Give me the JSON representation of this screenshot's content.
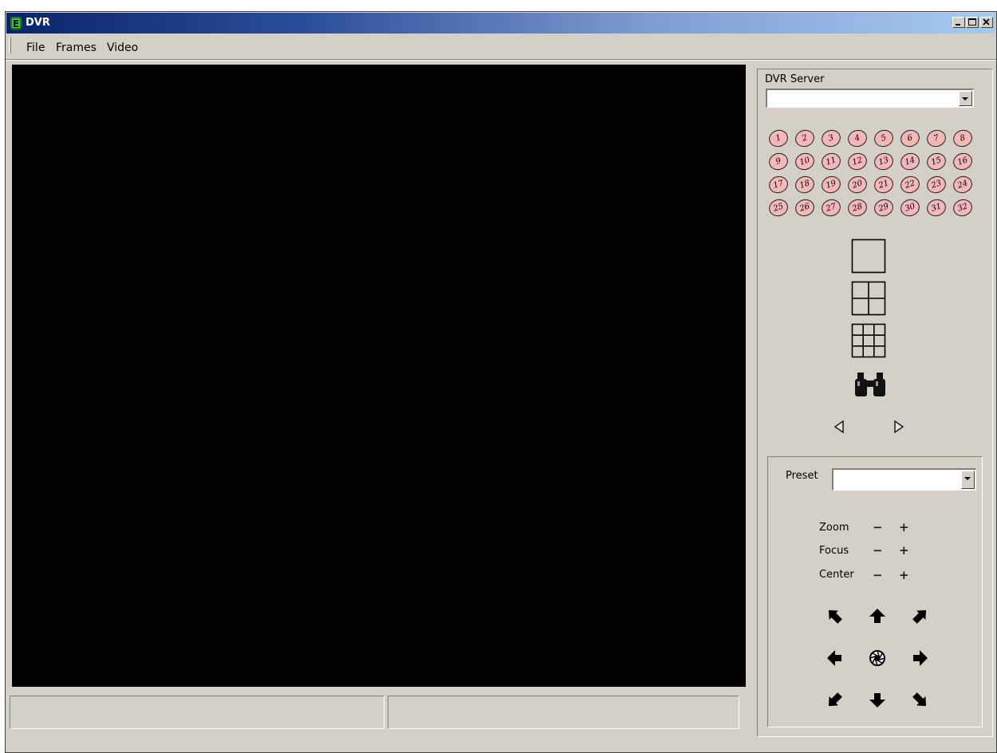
{
  "window": {
    "title": "DVR",
    "controls": [
      "minimize-icon",
      "maximize-icon",
      "close-icon"
    ]
  },
  "menu": {
    "items": [
      "File",
      "Frames",
      "Video"
    ]
  },
  "status_bar": {
    "left": "",
    "right": ""
  },
  "server_panel": {
    "label": "DVR Server",
    "server_value": "",
    "cameras": [
      "1",
      "2",
      "3",
      "4",
      "5",
      "6",
      "7",
      "8",
      "9",
      "10",
      "11",
      "12",
      "13",
      "14",
      "15",
      "16",
      "17",
      "18",
      "19",
      "20",
      "21",
      "22",
      "23",
      "24",
      "25",
      "26",
      "27",
      "28",
      "29",
      "30",
      "31",
      "32"
    ],
    "layout_buttons": [
      "single-view-icon",
      "quad-view-icon",
      "nine-view-icon"
    ],
    "search_icon": "binoculars-icon",
    "nav_icons": [
      "prev-arrow-icon",
      "next-arrow-icon"
    ]
  },
  "ptz": {
    "preset_label": "Preset",
    "preset_value": "",
    "zoom_label": "Zoom",
    "focus_label": "Focus",
    "center_label": "Center",
    "minus": "−",
    "plus": "+"
  },
  "colors": {
    "titlebar_start": "#0a246a",
    "titlebar_end": "#a6caf0",
    "face": "#d4d0c8",
    "video_background": "#000000",
    "camera_button": "#f4b8b8"
  }
}
